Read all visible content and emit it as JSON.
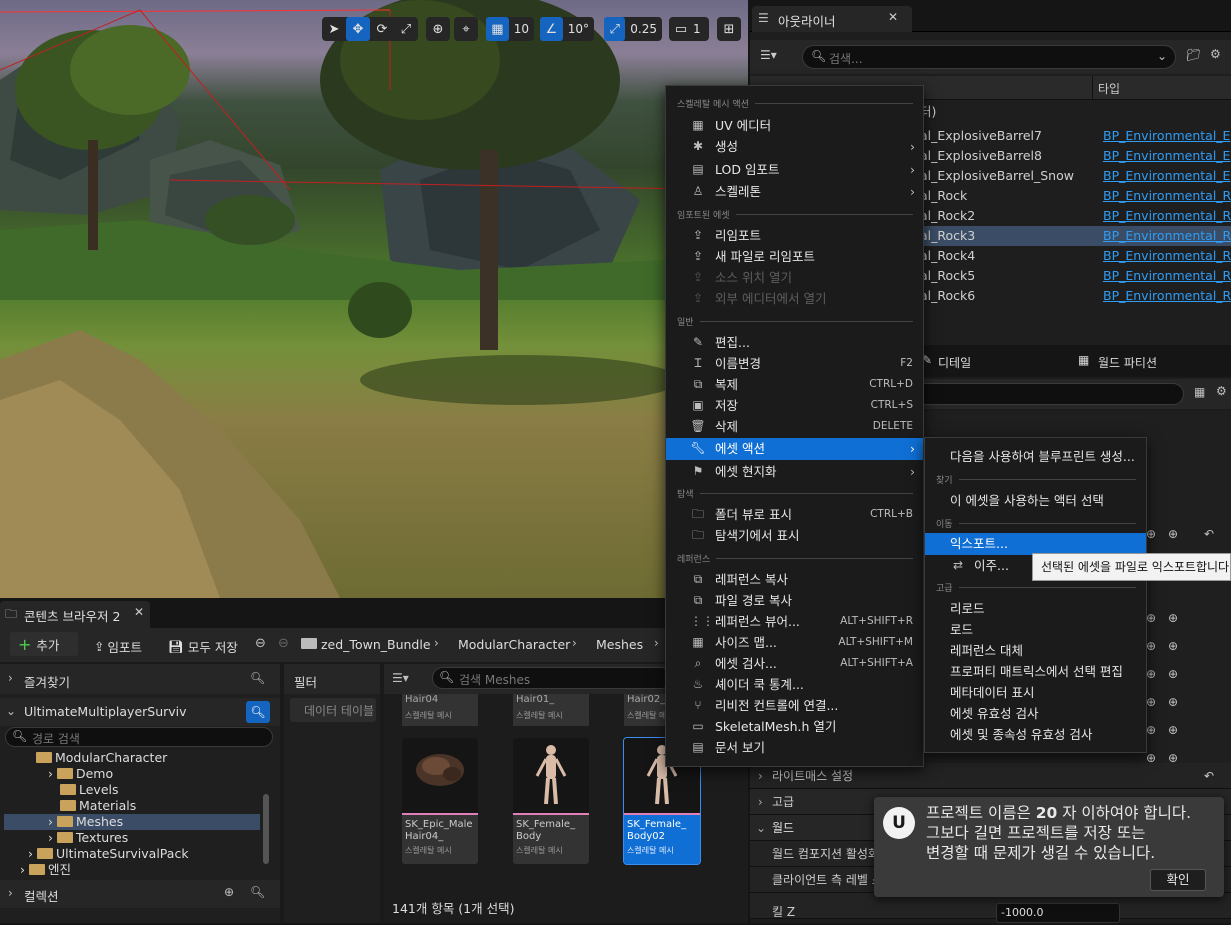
{
  "viewport": {
    "toolbar": {
      "grid_snap": "10",
      "rotation_snap": "10°",
      "scale_snap": "0.25",
      "camera_speed": "1"
    }
  },
  "outliner": {
    "tab_title": "아웃라이너",
    "search_placeholder": "검색...",
    "col_type": "타입",
    "partial_row": "터)",
    "rows": [
      {
        "name": "al_ExplosiveBarrel7",
        "type": "BP_Environmental_E"
      },
      {
        "name": "al_ExplosiveBarrel8",
        "type": "BP_Environmental_E"
      },
      {
        "name": "al_ExplosiveBarrel_Snow",
        "type": "BP_Environmental_E"
      },
      {
        "name": "al_Rock",
        "type": "BP_Environmental_R"
      },
      {
        "name": "al_Rock2",
        "type": "BP_Environmental_R"
      },
      {
        "name": "al_Rock3",
        "type": "BP_Environmental_R"
      },
      {
        "name": "al_Rock4",
        "type": "BP_Environmental_R"
      },
      {
        "name": "al_Rock5",
        "type": "BP_Environmental_R"
      },
      {
        "name": "al_Rock6",
        "type": "BP_Environmental_R"
      }
    ]
  },
  "details": {
    "tab_details": "디테일",
    "tab_world_partition": "월드 파티션",
    "rows": [
      "라이트매스 설정",
      "고급",
      "월드"
    ],
    "sub_rows": [
      "월드 컴포지션 활성화",
      "클라이언트 측 레벨 스",
      "킬 Z"
    ],
    "killz_value": "-1000.0"
  },
  "context_menu": {
    "sec_skeletal": "스켈레탈 메시 액션",
    "uv_editor": "UV 에디터",
    "create": "생성",
    "lod_import": "LOD 임포트",
    "skeleton": "스켈레톤",
    "sec_imported": "임포트된 에셋",
    "reimport": "리임포트",
    "reimport_new": "새 파일로 리임포트",
    "open_source": "소스 위치 열기",
    "open_external": "외부 에디터에서 열기",
    "sec_common": "일반",
    "edit": "편집...",
    "rename": "이름변경",
    "rename_sc": "F2",
    "duplicate": "복제",
    "duplicate_sc": "CTRL+D",
    "save": "저장",
    "save_sc": "CTRL+S",
    "delete": "삭제",
    "delete_sc": "DELETE",
    "asset_actions": "에셋 액션",
    "asset_localize": "에셋 현지화",
    "sec_explore": "탐색",
    "folder_view": "폴더 뷰로 표시",
    "folder_view_sc": "CTRL+B",
    "show_explorer": "탐색기에서 표시",
    "sec_references": "레퍼런스",
    "copy_reference": "레퍼런스 복사",
    "copy_path": "파일 경로 복사",
    "ref_viewer": "레퍼런스 뷰어...",
    "ref_viewer_sc": "ALT+SHIFT+R",
    "size_map": "사이즈 맵...",
    "size_map_sc": "ALT+SHIFT+M",
    "audit": "에셋 검사...",
    "audit_sc": "ALT+SHIFT+A",
    "shader_cook": "셰이더 쿡 통계...",
    "revision_control": "리비전 컨트롤에 연결...",
    "open_header": "SkeletalMesh.h 열기",
    "view_docs": "문서 보기"
  },
  "submenu": {
    "create_bp": "다음을 사용하여 블루프린트 생성...",
    "sec_find": "찾기",
    "select_actors": "이 에셋을 사용하는 액터 선택",
    "sec_move": "이동",
    "export": "익스포트...",
    "migrate": "이주...",
    "sec_advanced": "고급",
    "reload": "리로드",
    "load": "로드",
    "replace_refs": "레퍼런스 대체",
    "property_matrix": "프로퍼티 매트릭스에서 선택 편집",
    "show_metadata": "메타데이터 표시",
    "validate": "에셋 유효성 검사",
    "validate_deps": "에셋 및 종속성 유효성 검사"
  },
  "tooltip": "선택된 에셋을 파일로 익스포트합니다.",
  "content_browser": {
    "tab_title": "콘텐츠 브라우저 2",
    "add": "추가",
    "import": "임포트",
    "save_all": "모두 저장",
    "breadcrumb": [
      "zed_Town_Bundle",
      "ModularCharacter",
      "Meshes"
    ],
    "favorites": "즐겨찾기",
    "project": "UltimateMultiplayerSurviv",
    "path_search": "경로 검색",
    "tree": [
      "ModularCharacter",
      "Demo",
      "Levels",
      "Materials",
      "Meshes",
      "Textures",
      "UltimateSurvivalPack",
      "엔진"
    ],
    "collections": "컬렉션",
    "filter_title": "필터",
    "filter_placeholder": "데이터 테이블",
    "search_placeholder": "검색 Meshes",
    "top_tiles": [
      {
        "name": "Hair04",
        "type": "스켈레탈 메시"
      },
      {
        "name": "Hair01_",
        "type": "스켈레탈 메시"
      },
      {
        "name": "Hair02_",
        "type": "스켈레탈 메시"
      }
    ],
    "tiles": [
      {
        "name": "SK_Epic_Male Hair04_",
        "type": "스켈레탈 메시"
      },
      {
        "name": "SK_Female_ Body",
        "type": "스켈레탈 메시"
      },
      {
        "name": "SK_Female_ Body02",
        "type": "스켈레탈 메시"
      }
    ],
    "status": "141개 항목 (1개 선택)"
  },
  "notification": {
    "line1_a": "프로젝트 이름은 ",
    "line1_num": "20",
    "line1_b": " 자 이하여야 합니다.",
    "line2": "그보다 길면 프로젝트를 저장 또는",
    "line3": "변경할 때 문제가 생길 수 있습니다.",
    "ok": "확인"
  }
}
